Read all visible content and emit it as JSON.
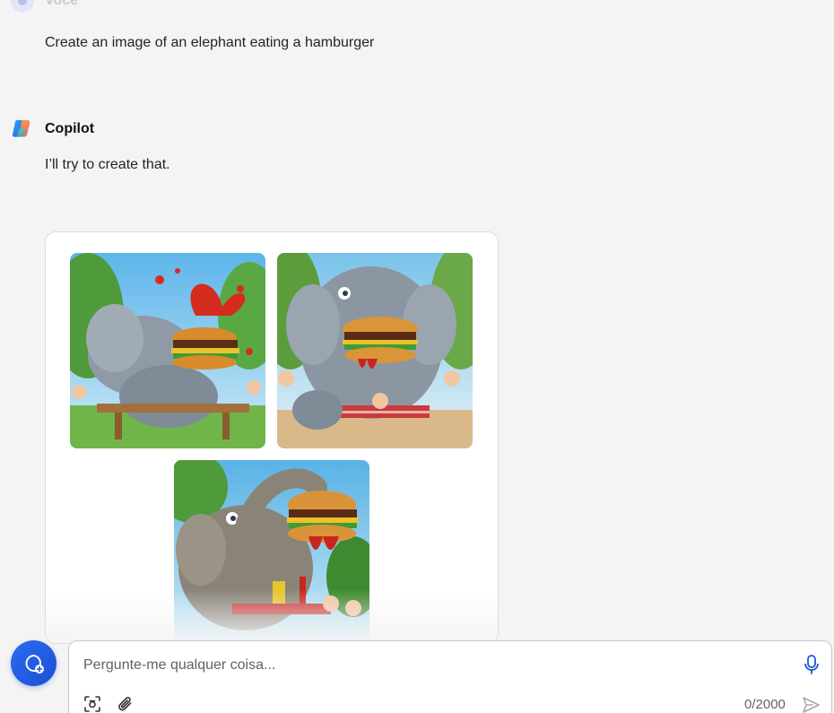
{
  "conversation": {
    "user": {
      "name": "Você",
      "message": "Create an image of an elephant eating a hamburger"
    },
    "assistant": {
      "name": "Copilot",
      "message": "I’ll try to create that."
    },
    "generated_images": [
      {
        "scene": "elephant-on-picnic-table-with-ketchup-splash"
      },
      {
        "scene": "elephant-holding-burger-with-crowd"
      },
      {
        "scene": "elephant-biting-burger-with-trunk"
      }
    ]
  },
  "composer": {
    "placeholder": "Pergunte-me qualquer coisa...",
    "char_count": "0/2000"
  },
  "icons": {
    "new_topic": "chat-plus-icon",
    "mic": "microphone-icon",
    "screenshot": "camera-scan-icon",
    "attach": "paperclip-icon",
    "send": "send-icon"
  },
  "colors": {
    "accent": "#2b6bef",
    "background": "#f4f4f5"
  }
}
